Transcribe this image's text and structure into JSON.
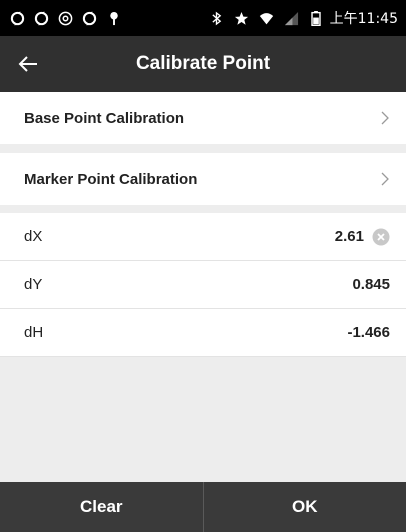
{
  "status_bar": {
    "time": "上午11:45",
    "left_icons": [
      "sync-icon",
      "sync-icon",
      "at-icon",
      "sync-icon",
      "location-pin-icon"
    ],
    "right_icons": [
      "bluetooth-icon",
      "star-icon",
      "wifi-icon",
      "signal-icon",
      "battery-icon"
    ]
  },
  "header": {
    "title": "Calibrate Point"
  },
  "menu": {
    "base_point": "Base Point Calibration",
    "marker_point": "Marker Point Calibration"
  },
  "params": [
    {
      "label": "dX",
      "value": "2.61"
    },
    {
      "label": "dY",
      "value": "0.845"
    },
    {
      "label": "dH",
      "value": "-1.466"
    }
  ],
  "footer": {
    "clear_label": "Clear",
    "ok_label": "OK"
  },
  "colors": {
    "status_bar": "#000000",
    "app_bar": "#303030",
    "background": "#ededed",
    "footer": "#3a3a3a"
  }
}
